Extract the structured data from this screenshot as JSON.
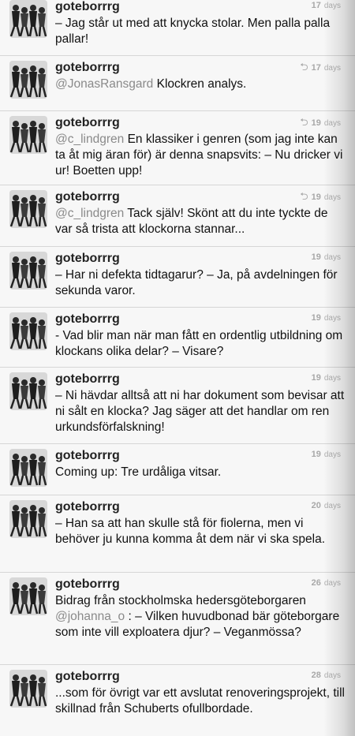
{
  "tweets": [
    {
      "username": "goteborrrg",
      "time_num": "17",
      "time_unit": "days",
      "reply": false,
      "mention": "",
      "text": "– Jag står ut med att knycka stolar. Men palla palla pallar!"
    },
    {
      "username": "goteborrrg",
      "time_num": "17",
      "time_unit": "days",
      "reply": true,
      "mention": "@JonasRansgard",
      "text": " Klockren analys."
    },
    {
      "username": "goteborrrg",
      "time_num": "19",
      "time_unit": "days",
      "reply": true,
      "mention": "@c_lindgren",
      "text": " En klassiker i genren (som jag inte kan ta åt mig äran för) är denna snapsvits: – Nu dricker vi ur! Boetten upp!"
    },
    {
      "username": "goteborrrg",
      "time_num": "19",
      "time_unit": "days",
      "reply": true,
      "mention": "@c_lindgren",
      "text": " Tack själv! Skönt att du inte tyckte de var så trista att klockorna stannar..."
    },
    {
      "username": "goteborrrg",
      "time_num": "19",
      "time_unit": "days",
      "reply": false,
      "mention": "",
      "text": "– Har ni defekta tidtagarur? – Ja, på avdelningen för sekunda varor."
    },
    {
      "username": "goteborrrg",
      "time_num": "19",
      "time_unit": "days",
      "reply": false,
      "mention": "",
      "text": "- Vad blir man när man fått en ordentlig utbildning om klockans olika delar? – Visare?"
    },
    {
      "username": "goteborrrg",
      "time_num": "19",
      "time_unit": "days",
      "reply": false,
      "mention": "",
      "text": "– Ni hävdar alltså att ni har dokument som bevisar att ni sålt en klocka? Jag säger att det handlar om ren urkundsförfalskning!"
    },
    {
      "username": "goteborrrg",
      "time_num": "19",
      "time_unit": "days",
      "reply": false,
      "mention": "",
      "text": "Coming up: Tre urdåliga vitsar."
    },
    {
      "username": "goteborrrg",
      "time_num": "20",
      "time_unit": "days",
      "reply": false,
      "mention": "",
      "text": "– Han sa att han skulle stå för fiolerna, men vi behöver ju kunna komma åt dem när vi ska spela."
    },
    {
      "username": "goteborrrg",
      "time_num": "26",
      "time_unit": "days",
      "reply": false,
      "mention": "",
      "text": "",
      "parts": [
        "Bidrag från stockholmska hedersgöteborgaren ",
        "@johanna_o",
        " : – Vilken huvudbonad bär göteborgare som inte vill exploatera djur? – Veganmössa?"
      ]
    },
    {
      "username": "goteborrrg",
      "time_num": "28",
      "time_unit": "days",
      "reply": false,
      "mention": "",
      "text": "...som för övrigt var ett avslutat renoveringsprojekt, till skillnad från Schuberts ofullbordade."
    }
  ]
}
